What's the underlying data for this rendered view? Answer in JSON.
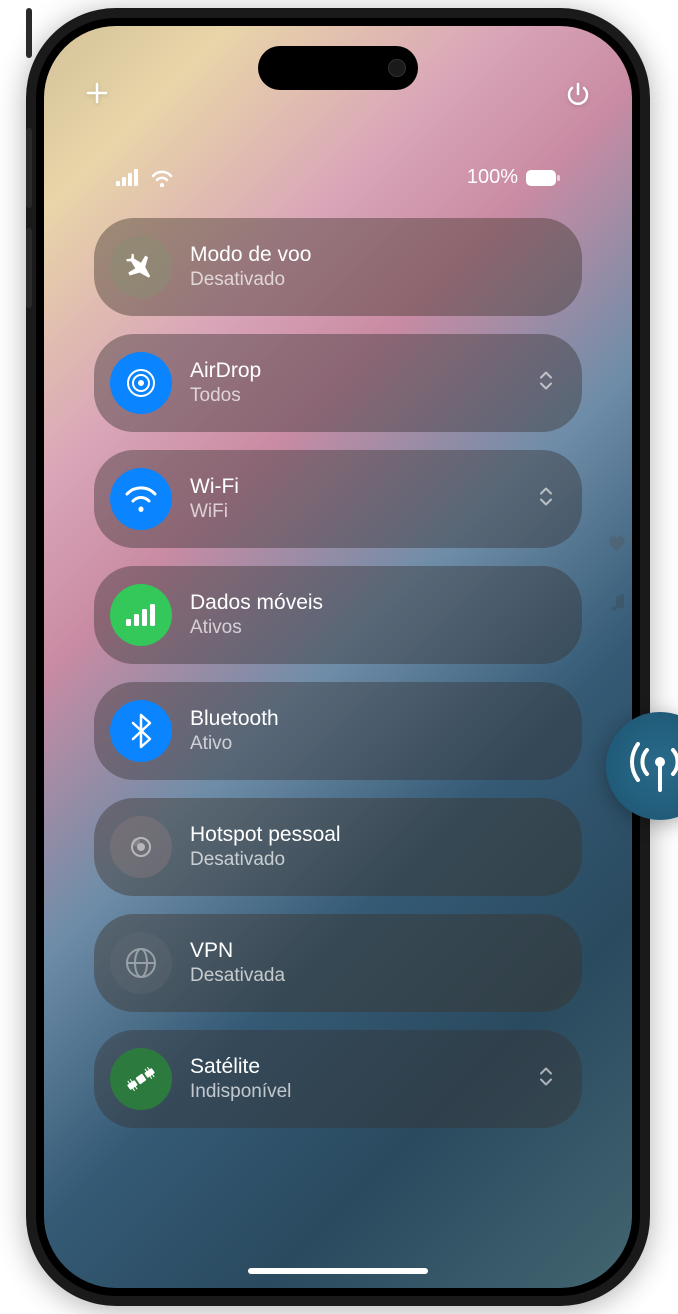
{
  "status": {
    "battery_text": "100%"
  },
  "controls": {
    "airplane": {
      "title": "Modo de voo",
      "status": "Desativado"
    },
    "airdrop": {
      "title": "AirDrop",
      "status": "Todos"
    },
    "wifi": {
      "title": "Wi-Fi",
      "status": "WiFi"
    },
    "cellular": {
      "title": "Dados móveis",
      "status": "Ativos"
    },
    "bluetooth": {
      "title": "Bluetooth",
      "status": "Ativo"
    },
    "hotspot": {
      "title": "Hotspot pessoal",
      "status": "Desativado"
    },
    "vpn": {
      "title": "VPN",
      "status": "Desativada"
    },
    "satellite": {
      "title": "Satélite",
      "status": "Indisponível"
    }
  },
  "colors": {
    "blue_active": "#0a84ff",
    "green_active": "#34c759",
    "satellite_green": "#2d7a3f"
  }
}
